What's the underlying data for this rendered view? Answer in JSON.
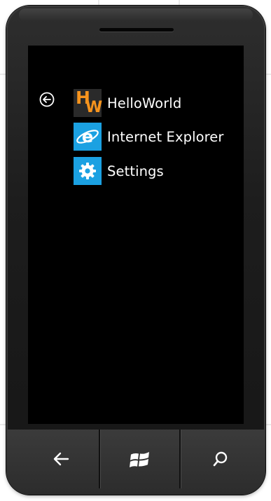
{
  "apps": [
    {
      "label": "HelloWorld",
      "icon": "helloworld-logo",
      "tile_color": "#2a2a2a",
      "logo_text_1": "H",
      "logo_text_2": "W",
      "logo_color": "#f7941d"
    },
    {
      "label": "Internet Explorer",
      "icon": "internet-explorer-icon",
      "tile_color": "#1ba1e2"
    },
    {
      "label": "Settings",
      "icon": "gear-icon",
      "tile_color": "#1ba1e2"
    }
  ],
  "screen": {
    "back_icon": "back-circle-icon",
    "background": "#000000",
    "text_color": "#ffffff"
  },
  "hardware_buttons": [
    {
      "icon": "back-arrow-icon"
    },
    {
      "icon": "windows-logo-icon"
    },
    {
      "icon": "search-icon"
    }
  ]
}
